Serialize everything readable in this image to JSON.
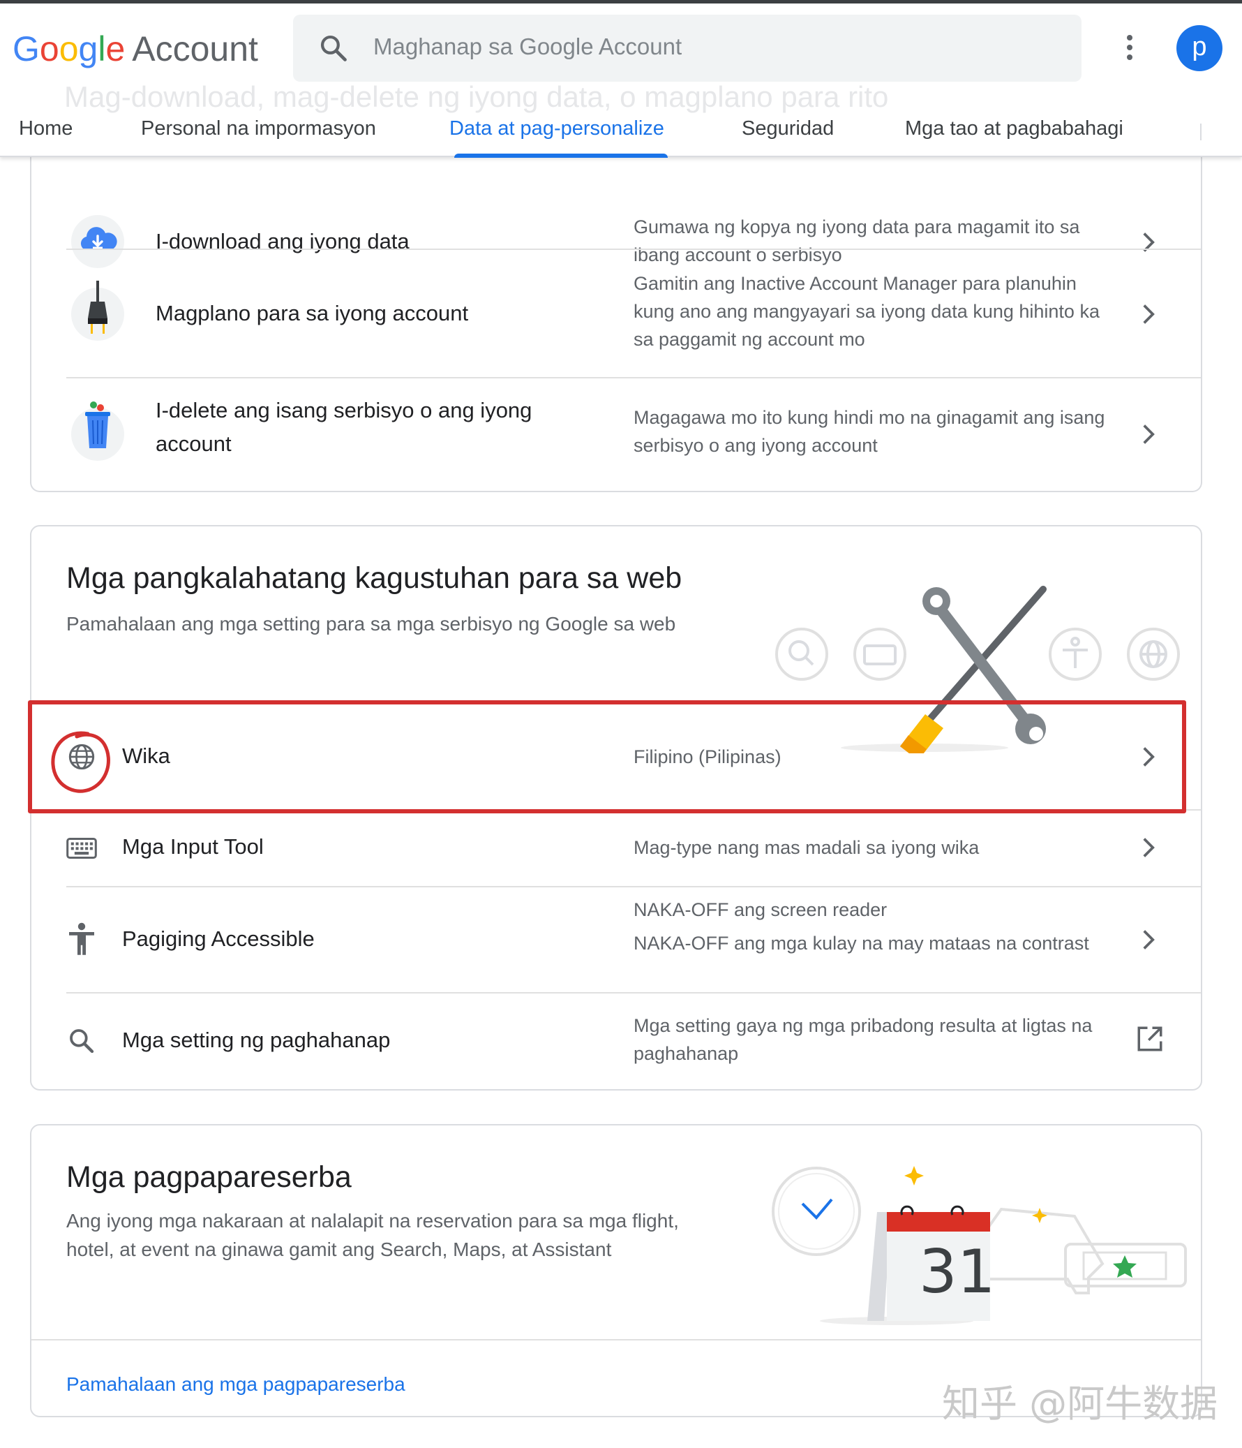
{
  "header": {
    "logo_google": [
      "G",
      "o",
      "o",
      "g",
      "l",
      "e"
    ],
    "logo_account": "Account",
    "search_placeholder": "Maghanap sa Google Account",
    "avatar_letter": "p",
    "ghost_title": "Mag-download, mag-delete ng iyong data, o magplano para rito"
  },
  "tabs": [
    {
      "label": "Home"
    },
    {
      "label": "Personal na impormasyon"
    },
    {
      "label": "Data at pag-personalize",
      "active": true
    },
    {
      "label": "Seguridad"
    },
    {
      "label": "Mga tao at pagbabahagi"
    }
  ],
  "data_section": {
    "rows": [
      {
        "title": "I-download ang iyong data",
        "desc": "Gumawa ng kopya ng iyong data para magamit ito sa ibang account o serbisyo",
        "icon": "cloud-download-icon"
      },
      {
        "title": "Magplano para sa iyong account",
        "desc": "Gamitin ang Inactive Account Manager para planuhin kung ano ang mangyayari sa iyong data kung hihinto ka sa paggamit ng account mo",
        "icon": "plug-icon"
      },
      {
        "title": "I-delete ang isang serbisyo o ang iyong account",
        "desc": "Magagawa mo ito kung hindi mo na ginagamit ang isang serbisyo o ang iyong account",
        "icon": "trash-can-icon"
      }
    ]
  },
  "web_prefs": {
    "title": "Mga pangkalahatang kagustuhan para sa web",
    "subtitle": "Pamahalaan ang mga setting para sa mga serbisyo ng Google sa web",
    "rows": [
      {
        "title": "Wika",
        "desc": "Filipino (Pilipinas)",
        "icon": "globe-icon"
      },
      {
        "title": "Mga Input Tool",
        "desc": "Mag-type nang mas madali sa iyong wika",
        "icon": "keyboard-icon"
      },
      {
        "title": "Pagiging Accessible",
        "desc_line1": "NAKA-OFF ang screen reader",
        "desc_line2": "NAKA-OFF ang mga kulay na may mataas na contrast",
        "icon": "accessibility-icon"
      },
      {
        "title": "Mga setting ng paghahanap",
        "desc": "Mga setting gaya ng mga pribadong resulta at ligtas na paghahanap",
        "icon": "search-icon",
        "action_icon": "open-in-new-icon"
      }
    ]
  },
  "reservations": {
    "title": "Mga pagpapareserba",
    "subtitle": "Ang iyong mga nakaraan at nalalapit na reservation para sa mga flight, hotel, at event na ginawa gamit ang Search, Maps, at Assistant",
    "calendar_day": "31",
    "link": "Pamahalaan ang mga pagpapareserba"
  },
  "watermark": "知乎 @阿牛数据",
  "colors": {
    "accent": "#1a73e8",
    "highlight": "#d32f2f",
    "text": "#202124",
    "muted": "#5f6368"
  }
}
